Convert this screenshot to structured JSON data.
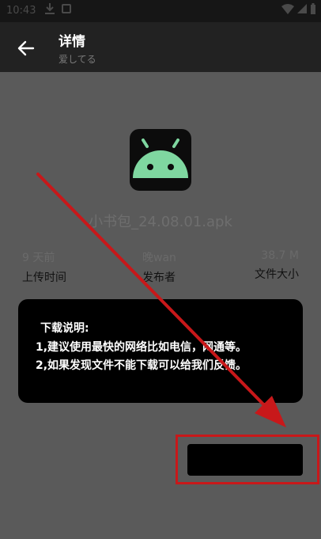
{
  "status_bar": {
    "time": "10:43",
    "icons": [
      "download-icon",
      "app-notification-icon",
      "wifi-icon",
      "signal-icon",
      "battery-icon"
    ]
  },
  "toolbar": {
    "title": "详情",
    "subtitle": "爱してる",
    "back_icon": "arrow-left-icon"
  },
  "app": {
    "icon": "android-robot-icon",
    "icon_color": "#7fd7a0",
    "file_name": "小书包_24.08.01.apk"
  },
  "stats": [
    {
      "value": "9 天前",
      "label": "上传时间"
    },
    {
      "value": "晚wan",
      "label": "发布者"
    },
    {
      "value": "38.7 M",
      "label": "文件大小"
    }
  ],
  "notice": {
    "title": "下载说明:",
    "lines": [
      "1,建议使用最快的网络比如电信，网通等。",
      "2,如果发现文件不能下载可以给我们反馈。"
    ]
  },
  "annotation": {
    "color": "#c8181a"
  }
}
